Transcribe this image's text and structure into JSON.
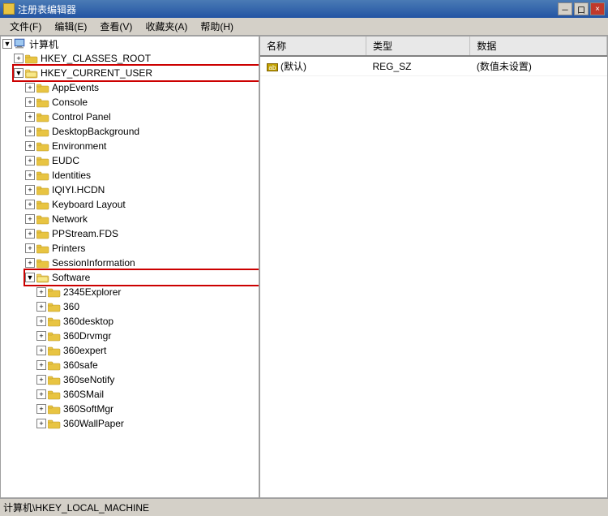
{
  "titleBar": {
    "title": "注册表编辑器",
    "iconAlt": "regedit-icon",
    "buttons": {
      "minimize": "－",
      "restore": "口",
      "close": "×"
    }
  },
  "menuBar": {
    "items": [
      {
        "label": "文件(F)"
      },
      {
        "label": "编辑(E)"
      },
      {
        "label": "查看(V)"
      },
      {
        "label": "收藏夹(A)"
      },
      {
        "label": "帮助(H)"
      }
    ]
  },
  "tree": {
    "computerLabel": "计算机",
    "nodes": [
      {
        "id": "hkcr",
        "label": "HKEY_CLASSES_ROOT",
        "level": 1,
        "expanded": false,
        "hasChildren": true,
        "highlighted": false
      },
      {
        "id": "hkcu",
        "label": "HKEY_CURRENT_USER",
        "level": 1,
        "expanded": true,
        "hasChildren": true,
        "highlighted": true,
        "children": [
          {
            "id": "appevents",
            "label": "AppEvents",
            "level": 2,
            "expanded": false,
            "hasChildren": true,
            "highlighted": false
          },
          {
            "id": "console",
            "label": "Console",
            "level": 2,
            "expanded": false,
            "hasChildren": true,
            "highlighted": false
          },
          {
            "id": "controlpanel",
            "label": "Control Panel",
            "level": 2,
            "expanded": false,
            "hasChildren": true,
            "highlighted": false
          },
          {
            "id": "desktopbg",
            "label": "DesktopBackground",
            "level": 2,
            "expanded": false,
            "hasChildren": true,
            "highlighted": false
          },
          {
            "id": "environment",
            "label": "Environment",
            "level": 2,
            "expanded": false,
            "hasChildren": true,
            "highlighted": false
          },
          {
            "id": "eudc",
            "label": "EUDC",
            "level": 2,
            "expanded": false,
            "hasChildren": true,
            "highlighted": false
          },
          {
            "id": "identities",
            "label": "Identities",
            "level": 2,
            "expanded": false,
            "hasChildren": true,
            "highlighted": false
          },
          {
            "id": "iqiyi",
            "label": "IQIYI.HCDN",
            "level": 2,
            "expanded": false,
            "hasChildren": true,
            "highlighted": false
          },
          {
            "id": "keyboard",
            "label": "Keyboard Layout",
            "level": 2,
            "expanded": false,
            "hasChildren": true,
            "highlighted": false
          },
          {
            "id": "network",
            "label": "Network",
            "level": 2,
            "expanded": false,
            "hasChildren": true,
            "highlighted": false
          },
          {
            "id": "ppstream",
            "label": "PPStream.FDS",
            "level": 2,
            "expanded": false,
            "hasChildren": true,
            "highlighted": false
          },
          {
            "id": "printers",
            "label": "Printers",
            "level": 2,
            "expanded": false,
            "hasChildren": true,
            "highlighted": false
          },
          {
            "id": "sessioninfo",
            "label": "SessionInformation",
            "level": 2,
            "expanded": false,
            "hasChildren": true,
            "highlighted": false
          },
          {
            "id": "software",
            "label": "Software",
            "level": 2,
            "expanded": true,
            "hasChildren": true,
            "highlighted": true,
            "children": [
              {
                "id": "2345explorer",
                "label": "2345Explorer",
                "level": 3,
                "expanded": false,
                "hasChildren": true,
                "highlighted": false
              },
              {
                "id": "360",
                "label": "360",
                "level": 3,
                "expanded": false,
                "hasChildren": true,
                "highlighted": false
              },
              {
                "id": "360desktop",
                "label": "360desktop",
                "level": 3,
                "expanded": false,
                "hasChildren": true,
                "highlighted": false
              },
              {
                "id": "360drvmgr",
                "label": "360Drvmgr",
                "level": 3,
                "expanded": false,
                "hasChildren": true,
                "highlighted": false
              },
              {
                "id": "360expert",
                "label": "360expert",
                "level": 3,
                "expanded": false,
                "hasChildren": true,
                "highlighted": false
              },
              {
                "id": "360safe",
                "label": "360safe",
                "level": 3,
                "expanded": false,
                "hasChildren": true,
                "highlighted": false
              },
              {
                "id": "360senotify",
                "label": "360seNotify",
                "level": 3,
                "expanded": false,
                "hasChildren": true,
                "highlighted": false
              },
              {
                "id": "360smail",
                "label": "360SMail",
                "level": 3,
                "expanded": false,
                "hasChildren": true,
                "highlighted": false
              },
              {
                "id": "360softmgr",
                "label": "360SoftMgr",
                "level": 3,
                "expanded": false,
                "hasChildren": true,
                "highlighted": false
              },
              {
                "id": "360wallpaper",
                "label": "360WallPaper",
                "level": 3,
                "expanded": false,
                "hasChildren": true,
                "highlighted": false
              }
            ]
          }
        ]
      }
    ]
  },
  "rightPanel": {
    "columns": [
      {
        "label": "名称"
      },
      {
        "label": "类型"
      },
      {
        "label": "数据"
      }
    ],
    "rows": [
      {
        "name": "ab|(默认)",
        "type": "REG_SZ",
        "data": "(数值未设置)",
        "isDefault": true
      }
    ]
  },
  "statusBar": {
    "text": "计算机\\HKEY_LOCAL_MACHINE"
  }
}
